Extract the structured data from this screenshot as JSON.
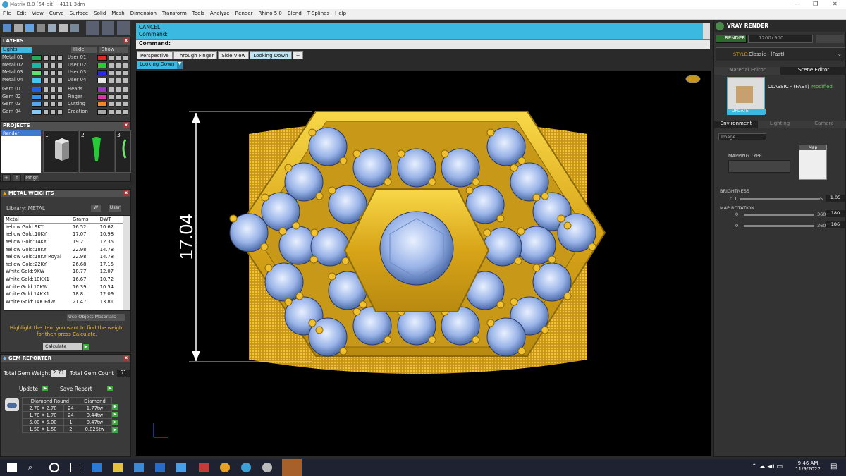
{
  "window": {
    "title": "Matrix 8.0 (64-bit) - 4111.3dm"
  },
  "menu": [
    "File",
    "Edit",
    "View",
    "Curve",
    "Surface",
    "Solid",
    "Mesh",
    "Dimension",
    "Transform",
    "Tools",
    "Analyze",
    "Render",
    "Rhino 5.0",
    "Blend",
    "T-Splines",
    "Help"
  ],
  "layers": {
    "title": "LAYERS",
    "lights": "Lights",
    "hide": "Hide",
    "show": "Show",
    "left": [
      {
        "name": "Metal 01",
        "color": "#28a85a"
      },
      {
        "name": "Metal 02",
        "color": "#18b8a8"
      },
      {
        "name": "Metal 03",
        "color": "#60e070"
      },
      {
        "name": "Metal 04",
        "color": "#40c8f0"
      },
      {
        "name": "Gem 01",
        "color": "#2060e8"
      },
      {
        "name": "Gem 02",
        "color": "#3890e8"
      },
      {
        "name": "Gem 03",
        "color": "#58a8f0"
      },
      {
        "name": "Gem 04",
        "color": "#88c8f8"
      }
    ],
    "right": [
      {
        "name": "User 01",
        "color": "#e02828"
      },
      {
        "name": "User 02",
        "color": "#28d028"
      },
      {
        "name": "User 03",
        "color": "#2828e8"
      },
      {
        "name": "User 04",
        "color": "#e8e8e8"
      },
      {
        "name": "Heads",
        "color": "#9838c8"
      },
      {
        "name": "Finger",
        "color": "#d838a8"
      },
      {
        "name": "Cutting",
        "color": "#f08828"
      },
      {
        "name": "Creation",
        "color": "#a8a8a8"
      }
    ]
  },
  "projects": {
    "title": "PROJECTS",
    "selected": "Render",
    "slots": [
      "1",
      "2",
      "3"
    ],
    "buttons": [
      "+",
      "↑",
      "Mngr"
    ]
  },
  "metal_weights": {
    "title": "METAL WEIGHTS",
    "library": "Library: METAL",
    "toggle_a": "W",
    "toggle_b": "User",
    "headers": [
      "Metal",
      "Grams",
      "DWT"
    ],
    "rows": [
      [
        "Yellow Gold:9KY",
        "16.52",
        "10.62"
      ],
      [
        "Yellow Gold:10KY",
        "17.07",
        "10.98"
      ],
      [
        "Yellow Gold:14KY",
        "19.21",
        "12.35"
      ],
      [
        "Yellow Gold:18KY",
        "22.98",
        "14.78"
      ],
      [
        "Yellow Gold:18KY Royal",
        "22.98",
        "14.78"
      ],
      [
        "Yellow Gold:22KY",
        "26.68",
        "17.15"
      ],
      [
        "White Gold:9KW",
        "18.77",
        "12.07"
      ],
      [
        "White Gold:10KX1",
        "16.67",
        "10.72"
      ],
      [
        "White Gold:10KW",
        "16.39",
        "10.54"
      ],
      [
        "White Gold:14KX1",
        "18.8",
        "12.09"
      ],
      [
        "White Gold:14K PdW",
        "21.47",
        "13.81"
      ]
    ],
    "use_object_materials": "Use Object Materials",
    "hint": "Highlight the item you want to find the weight for then press Calculate.",
    "calculate": "Calculate"
  },
  "gem_reporter": {
    "title": "GEM REPORTER",
    "total_weight_label": "Total Gem Weight",
    "total_weight": "2.71",
    "total_count_label": "Total Gem Count",
    "total_count": "51",
    "update": "Update",
    "save_report": "Save Report",
    "headers": [
      "Diamond Round",
      "Diamond"
    ],
    "rows": [
      [
        "2.70 X 2.70",
        "24",
        "1.77tw"
      ],
      [
        "1.70 X 1.70",
        "24",
        "0.44tw"
      ],
      [
        "5.00 X 5.00",
        "1",
        "0.47tw"
      ],
      [
        "1.50 X 1.50",
        "2",
        "0.025tw"
      ]
    ]
  },
  "command": {
    "line1": "CANCEL",
    "line2": "Command:",
    "prompt": "Command:"
  },
  "view_tabs": [
    "Perspective",
    "Through Finger",
    "Side View",
    "Looking Down"
  ],
  "view_dropdown": "Looking Down",
  "dimension": "17.04",
  "vray": {
    "title": "VRAY RENDER",
    "render": "RENDER",
    "resolution": "1200x900",
    "style_label": "STYLE:",
    "style_value": "Classic - (Fast)",
    "tabs": [
      "Material Editor",
      "Scene Editor"
    ],
    "preset": "CLASSIC - (FAST)",
    "modified": "Modified",
    "update": "UPDATE",
    "sub_tabs": [
      "Environment",
      "Lighting",
      "Camera"
    ],
    "env_type": "Image",
    "mapping_type": "MAPPING TYPE",
    "map": "Map",
    "brightness_label": "BRIGHTNESS",
    "brightness_min": "0.1",
    "brightness_max": "5",
    "brightness_value": "1.05",
    "rotation_label": "MAP ROTATION",
    "rot1_min": "0",
    "rot1_max": "360",
    "rot1_value": "180",
    "rot2_min": "0",
    "rot2_max": "360",
    "rot2_value": "186"
  },
  "clock": {
    "time": "9:46 AM",
    "date": "11/9/2022"
  }
}
